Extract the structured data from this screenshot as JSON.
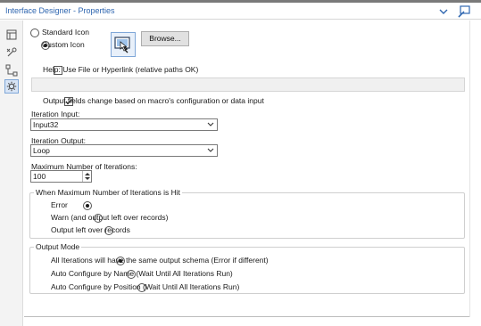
{
  "window": {
    "title": "Interface Designer - Properties"
  },
  "sidebar": {
    "items": [
      {
        "icon": "layout-icon"
      },
      {
        "icon": "tools-icon"
      },
      {
        "icon": "tree-icon"
      },
      {
        "icon": "gear-icon",
        "active": true
      }
    ]
  },
  "icon_options": {
    "standard_label": "Standard Icon",
    "custom_label": "Custom Icon",
    "selected": "Custom Icon",
    "browse_label": "Browse..."
  },
  "help": {
    "checkbox_label": "Help: Use File or Hyperlink (relative paths OK)",
    "checked": false,
    "value": ""
  },
  "output_fields": {
    "checkbox_label": "Output fields change based on macro's configuration or data input",
    "checked": true
  },
  "iteration_input": {
    "label": "Iteration Input:",
    "value": "Input32"
  },
  "iteration_output": {
    "label": "Iteration Output:",
    "value": "Loop"
  },
  "max_iterations": {
    "label": "Maximum Number of Iterations:",
    "value": "100"
  },
  "max_hit_group": {
    "title": "When Maximum Number of Iterations is Hit",
    "options": [
      "Error",
      "Warn (and output left over records)",
      "Output left over records"
    ],
    "selected": "Error"
  },
  "output_mode_group": {
    "title": "Output Mode",
    "options": [
      "All Iterations will have the same output schema (Error if different)",
      "Auto Configure by Name (Wait Until All Iterations Run)",
      "Auto Configure by Position (Wait Until All Iterations Run)"
    ],
    "selected": "All Iterations will have the same output schema (Error if different)"
  }
}
